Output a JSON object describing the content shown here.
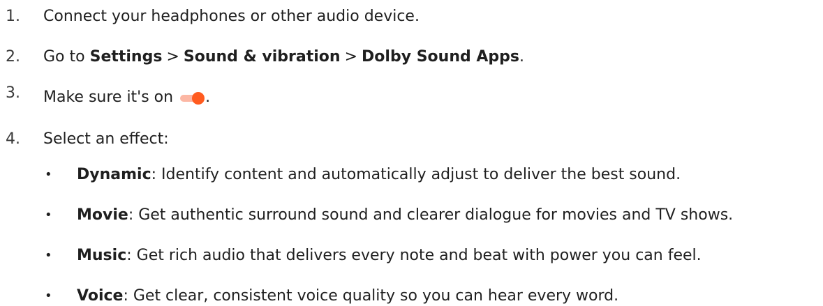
{
  "steps": [
    {
      "number": "1.",
      "text": "Connect your headphones or other audio device."
    },
    {
      "number": "2.",
      "prefix": "Go to",
      "path": [
        "Settings",
        "Sound & vibration",
        "Dolby Sound Apps"
      ],
      "separator": ">",
      "suffix": "."
    },
    {
      "number": "3.",
      "text": "Make sure it's on",
      "icon": "toggle-on-icon",
      "suffix": "."
    },
    {
      "number": "4.",
      "text": "Select an effect:"
    }
  ],
  "effects": [
    {
      "bullet": "•",
      "name": "Dynamic",
      "description": ": Identify content and automatically adjust to deliver the best sound."
    },
    {
      "bullet": "•",
      "name": "Movie",
      "description": ": Get authentic surround sound and clearer dialogue for movies and TV shows."
    },
    {
      "bullet": "•",
      "name": "Music",
      "description": ": Get rich audio that delivers every note and beat with power you can feel."
    },
    {
      "bullet": "•",
      "name": "Voice",
      "description": ": Get clear, consistent voice quality so you can hear every word."
    }
  ],
  "colors": {
    "text": "#1f1f1f",
    "toggle_thumb": "#ff5b1f",
    "toggle_track": "#fcb7a4"
  }
}
